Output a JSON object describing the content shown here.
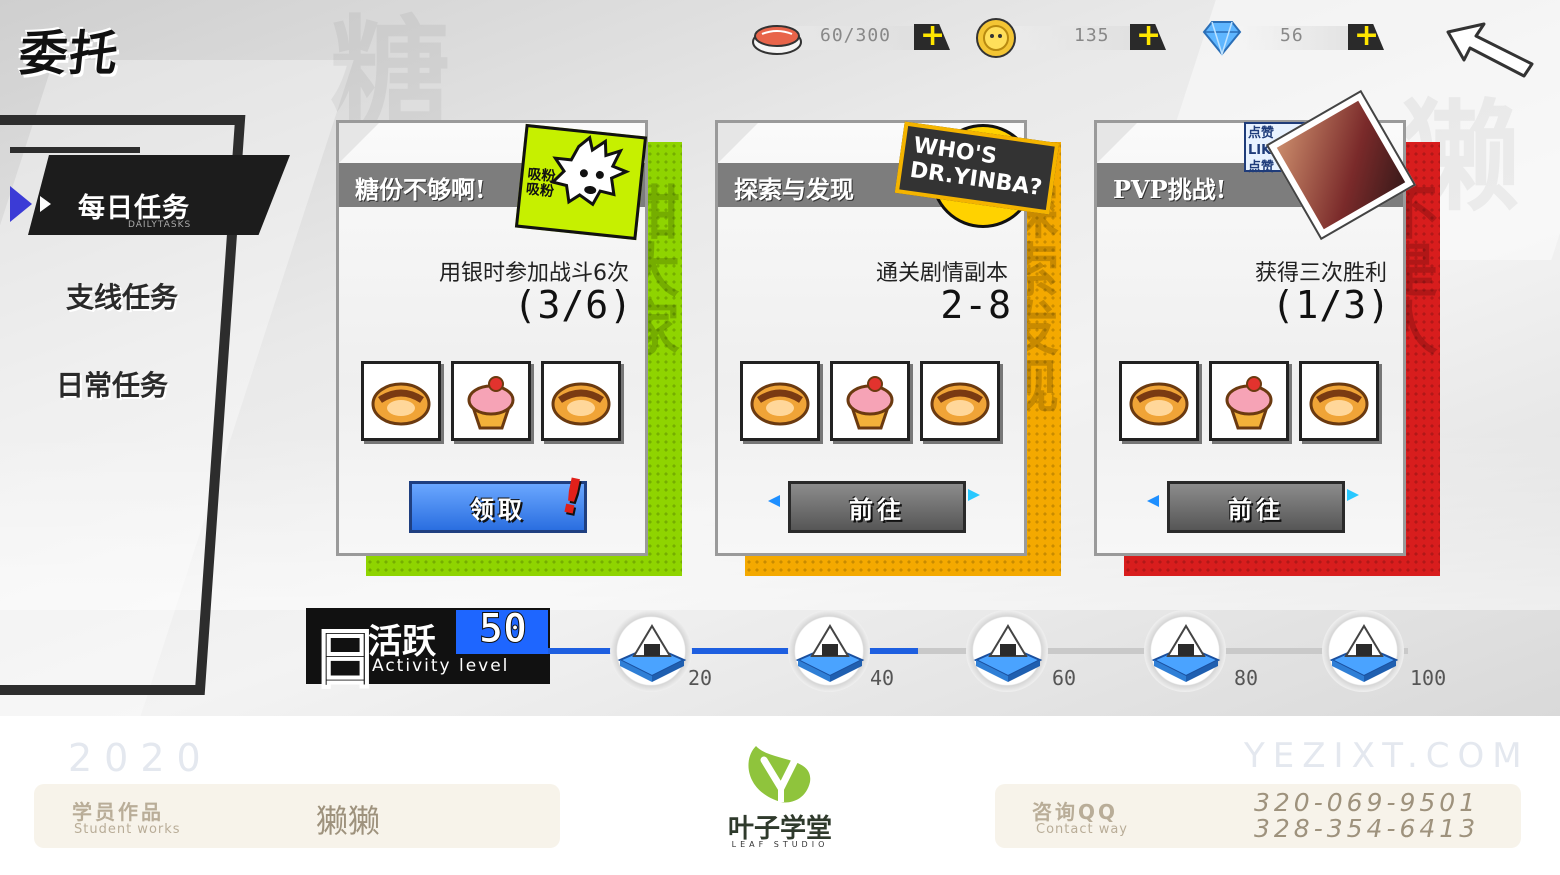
{
  "title": "委托",
  "resources": [
    {
      "icon": "sushi-icon",
      "value": "60/300"
    },
    {
      "icon": "coin-icon",
      "value": "135"
    },
    {
      "icon": "diamond-icon",
      "value": "56"
    }
  ],
  "nav": {
    "daily": {
      "label": "每日任务",
      "sub": "DAILYTASKS"
    },
    "side": {
      "label": "支线任务"
    },
    "routine": {
      "label": "日常任务"
    }
  },
  "cards": [
    {
      "title": "糖份不够啊!",
      "task": "用银时参加战斗6次",
      "progress": "(3/6)",
      "button": "领取",
      "bang": "!",
      "accent": "#8fd400",
      "sticker": {
        "lines": [
          "吸粉",
          "吸粉"
        ]
      }
    },
    {
      "title": "探索与发现",
      "task": "通关剧情副本",
      "progress": "2-8",
      "button": "前往",
      "accent": "#f4a900",
      "sticker": {
        "lines": [
          "WHO'S",
          "DR.YINBA?"
        ]
      }
    },
    {
      "title": "PVP挑战!",
      "task": "获得三次胜利",
      "progress": "(1/3)",
      "button": "前往",
      "accent": "#d81d1d",
      "sticker": {
        "lines": [
          "点赞LIKE",
          "点赞"
        ]
      }
    }
  ],
  "activity": {
    "day_char": "日",
    "label": "活跃",
    "value": "50",
    "sub": "Activity level",
    "fill_fraction": 0.43,
    "milestones": [
      "20",
      "40",
      "60",
      "80",
      "100"
    ]
  },
  "footer": {
    "year": "2020",
    "site": "YEZIXT.COM",
    "works_title": "学员作品",
    "works_sub": "Student works",
    "author": "獭獭",
    "contact_title": "咨询QQ",
    "contact_sub": "Contact way",
    "phones": [
      "320-069-9501",
      "328-354-6413"
    ],
    "brand": "叶子学堂",
    "brand_sub": "LEAF STUDIO"
  }
}
